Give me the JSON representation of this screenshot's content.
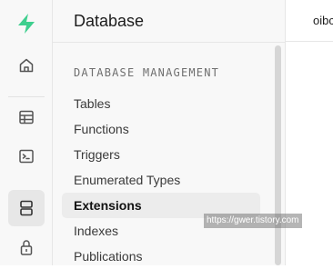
{
  "rail": {
    "icons": [
      {
        "name": "supabase-logo-icon"
      },
      {
        "name": "home-icon"
      },
      {
        "name": "table-editor-icon"
      },
      {
        "name": "sql-editor-icon"
      },
      {
        "name": "database-icon",
        "active": true
      },
      {
        "name": "auth-lock-icon"
      }
    ],
    "brand_color": "#3ecf8e"
  },
  "menu": {
    "title": "Database",
    "section_title": "DATABASE MANAGEMENT",
    "items": [
      {
        "label": "Tables"
      },
      {
        "label": "Functions"
      },
      {
        "label": "Triggers"
      },
      {
        "label": "Enumerated Types"
      },
      {
        "label": "Extensions",
        "active": true
      },
      {
        "label": "Indexes"
      },
      {
        "label": "Publications"
      }
    ]
  },
  "main": {
    "header_text": "oibc"
  },
  "watermark": {
    "text": "https://gwer.tistory.com"
  }
}
